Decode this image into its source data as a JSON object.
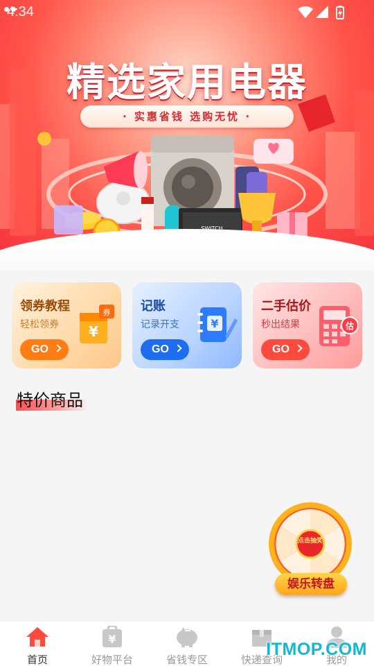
{
  "status_bar": {
    "time": "4:34"
  },
  "banner": {
    "title": "精选家用电器",
    "subtitle": "· 实惠省钱  选购无忧 ·"
  },
  "cards": [
    {
      "title": "领券教程",
      "subtitle": "轻松领券",
      "button": "GO",
      "icon": "coupon-icon"
    },
    {
      "title": "记账",
      "subtitle": "记录开支",
      "button": "GO",
      "icon": "ledger-icon"
    },
    {
      "title": "二手估价",
      "subtitle": "秒出结果",
      "button": "GO",
      "icon": "calculator-icon"
    }
  ],
  "section": {
    "title": "特价商品"
  },
  "wheel": {
    "label": "娱乐转盘",
    "center": "点击抽奖"
  },
  "bottom_nav": [
    {
      "label": "首页",
      "icon": "home-icon",
      "active": true
    },
    {
      "label": "好物平台",
      "icon": "shopping-bag-icon",
      "active": false
    },
    {
      "label": "省钱专区",
      "icon": "piggy-bank-icon",
      "active": false
    },
    {
      "label": "快递查询",
      "icon": "package-icon",
      "active": false
    },
    {
      "label": "我的",
      "icon": "user-icon",
      "active": false
    }
  ],
  "watermark": "ITMOP.COM",
  "colors": {
    "accent": "#ff4a3d",
    "banner": "#f5323c",
    "nav_active": "#ff4a3d",
    "nav_inactive": "#c8c8c8"
  }
}
